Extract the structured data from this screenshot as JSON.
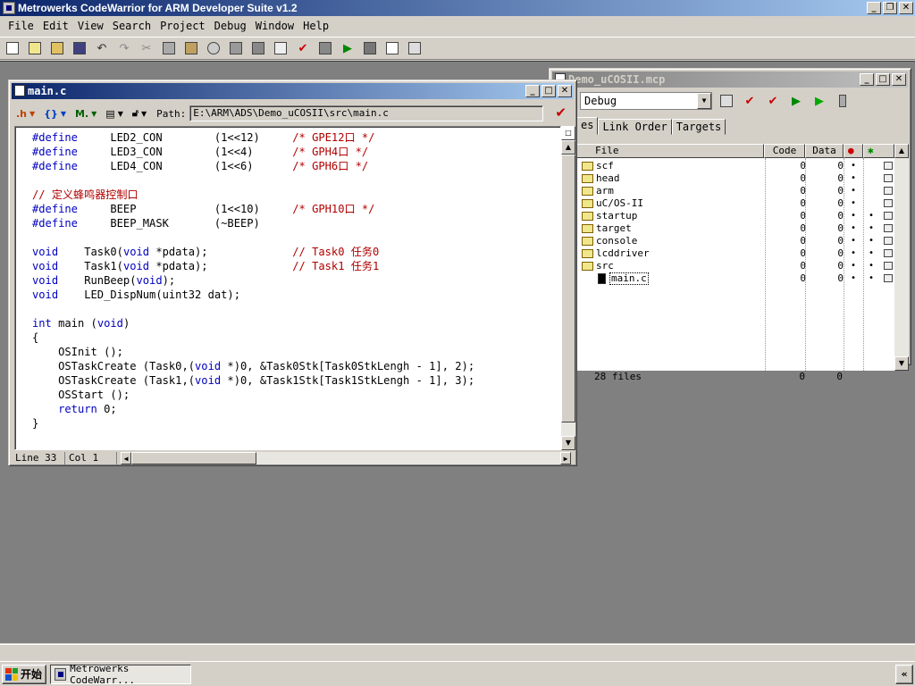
{
  "app": {
    "title": "Metrowerks CodeWarrior for ARM Developer Suite v1.2",
    "caption_buttons": {
      "min": "_",
      "restore": "❐",
      "close": "✕"
    }
  },
  "menu": [
    "File",
    "Edit",
    "View",
    "Search",
    "Project",
    "Debug",
    "Window",
    "Help"
  ],
  "toolbar": {
    "icons": [
      "new-text-file-icon",
      "new-project-icon",
      "open-icon",
      "save-icon",
      "undo-icon",
      "redo-icon",
      "cut-icon",
      "copy-icon",
      "paste-icon",
      "find-icon",
      "replace-icon",
      "compile-icon",
      "settings-icon",
      "check-syntax-icon",
      "make-icon",
      "debug-icon",
      "stop-icon",
      "file-info-icon",
      "project-window-icon"
    ]
  },
  "editor": {
    "title": "main.c",
    "path_label": "Path:",
    "path": "E:\\ARM\\ADS\\Demo_uCOSII\\src\\main.c",
    "status": {
      "line": "Line 33",
      "col": "Col 1"
    },
    "code_lines": [
      "#define     LED2_CON        (1<<12)     /* GPE12口 */",
      "#define     LED3_CON        (1<<4)      /* GPH4口 */",
      "#define     LED4_CON        (1<<6)      /* GPH6口 */",
      "",
      "// 定义蜂鸣器控制口",
      "#define     BEEP            (1<<10)     /* GPH10口 */",
      "#define     BEEP_MASK       (~BEEP)",
      "",
      "void    Task0(void *pdata);             // Task0 任务0",
      "void    Task1(void *pdata);             // Task1 任务1",
      "void    RunBeep(void);",
      "void    LED_DispNum(uint32 dat);",
      "",
      "int main (void)",
      "{",
      "    OSInit ();",
      "    OSTaskCreate (Task0,(void *)0, &Task0Stk[Task0StkLengh - 1], 2);",
      "    OSTaskCreate (Task1,(void *)0, &Task1Stk[Task1StkLengh - 1], 3);",
      "    OSStart ();",
      "    return 0;",
      "}"
    ]
  },
  "project": {
    "title": "Demo_uCOSII.mcp",
    "target": "Debug",
    "tabs": [
      "es",
      "Link Order",
      "Targets"
    ],
    "columns": {
      "file": "File",
      "code": "Code",
      "data": "Data"
    },
    "files": [
      {
        "name": "scf",
        "code": "0",
        "data": "0",
        "kind": "folder"
      },
      {
        "name": "head",
        "code": "0",
        "data": "0",
        "kind": "folder"
      },
      {
        "name": "arm",
        "code": "0",
        "data": "0",
        "kind": "folder"
      },
      {
        "name": "uC/OS-II",
        "code": "0",
        "data": "0",
        "kind": "folder"
      },
      {
        "name": "startup",
        "code": "0",
        "data": "0",
        "kind": "folder"
      },
      {
        "name": "target",
        "code": "0",
        "data": "0",
        "kind": "folder"
      },
      {
        "name": "console",
        "code": "0",
        "data": "0",
        "kind": "folder"
      },
      {
        "name": "lcddriver",
        "code": "0",
        "data": "0",
        "kind": "folder"
      },
      {
        "name": "src",
        "code": "0",
        "data": "0",
        "kind": "folder"
      },
      {
        "name": "main.c",
        "code": "0",
        "data": "0",
        "kind": "file"
      }
    ],
    "footer": {
      "count": "28 files",
      "code": "0",
      "data": "0"
    },
    "dot": "•"
  },
  "taskbar": {
    "start": "开始",
    "app_button": "Metrowerks CodeWarr...",
    "tray": "«"
  }
}
